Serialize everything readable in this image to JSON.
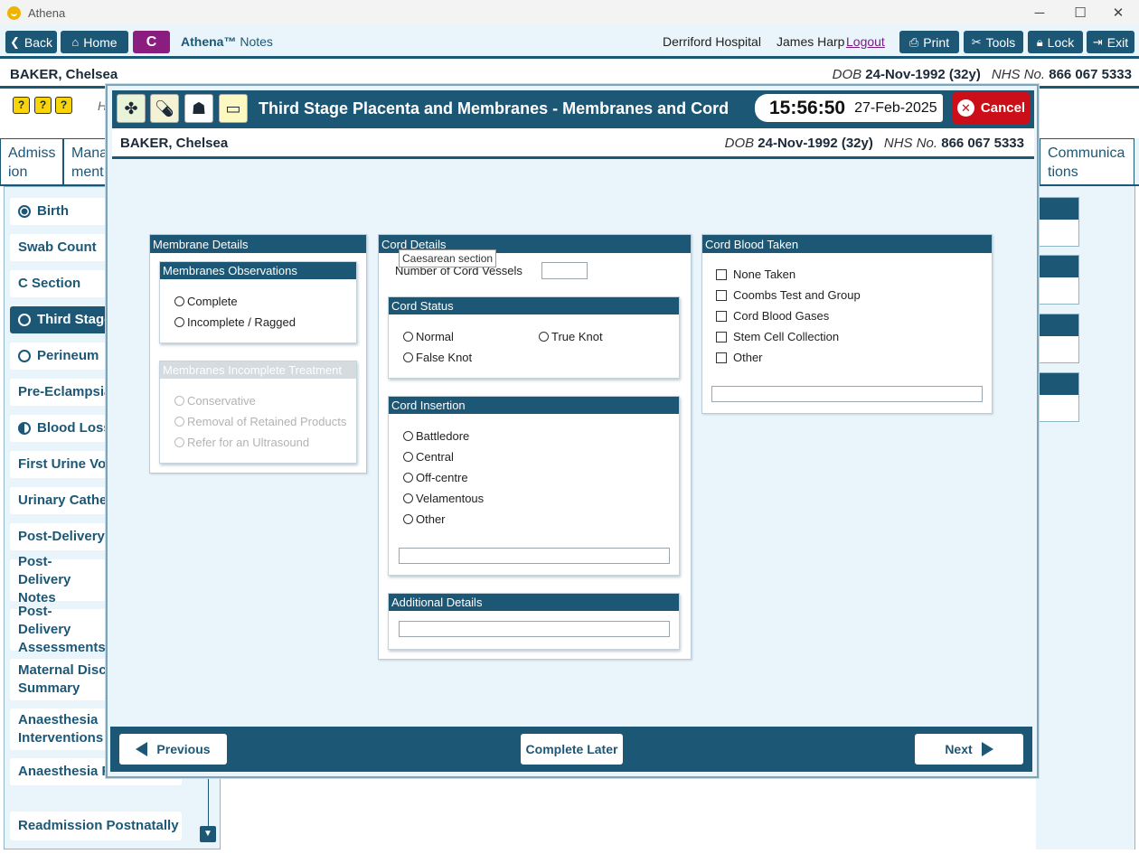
{
  "window": {
    "title": "Athena",
    "controls": [
      "─",
      "☐",
      "✕"
    ]
  },
  "toolbar": {
    "back": "Back",
    "home": "Home",
    "c_button": "C",
    "brand_main": "Athena™",
    "brand_sub": "Notes",
    "hospital": "Derriford Hospital",
    "user": "James Harp",
    "logout": "Logout",
    "print": "Print",
    "tools": "Tools",
    "lock": "Lock",
    "exit": "Exit"
  },
  "patient": {
    "name": "BAKER, Chelsea",
    "dob_label": "DOB",
    "dob": "24-Nov-1992 (32y)",
    "nhs_label": "NHS No.",
    "nhs": "866 067 5333"
  },
  "alerts": {
    "icons": [
      "?",
      "?",
      "?"
    ],
    "hint": "H"
  },
  "tabs": [
    {
      "label": "Admiss ion"
    },
    {
      "label": "Mana ment"
    },
    {
      "label": "Communica tions"
    }
  ],
  "sidebar": {
    "items": [
      {
        "label": "Birth",
        "state": "filled"
      },
      {
        "label": "Swab Count",
        "state": ""
      },
      {
        "label": "C Section",
        "state": ""
      },
      {
        "label": "Third Stage",
        "state": "empty",
        "active": true
      },
      {
        "label": "Perineum",
        "state": "empty"
      },
      {
        "label": "Pre-Eclampsia",
        "state": ""
      },
      {
        "label": "Blood Loss",
        "state": "half"
      },
      {
        "label": "First Urine Voi",
        "state": ""
      },
      {
        "label": "Urinary Cathe",
        "state": ""
      },
      {
        "label": "Post-Delivery",
        "state": ""
      },
      {
        "label": "Post-Delivery Notes",
        "state": ""
      },
      {
        "label": "Post-Delivery Assessments",
        "state": ""
      },
      {
        "label": "Maternal Disc Summary",
        "state": ""
      },
      {
        "label": "Anaesthesia Interventions",
        "state": ""
      },
      {
        "label": "Anaesthesia F",
        "state": ""
      },
      {
        "label": "Readmission Postnatally",
        "state": ""
      }
    ]
  },
  "dialog": {
    "title": "Third Stage Placenta and Membranes - Membranes and Cord",
    "time": "15:56:50",
    "date": "27-Feb-2025",
    "cancel": "Cancel",
    "membrane_details": {
      "header": "Membrane Details",
      "observations": {
        "header": "Membranes Observations",
        "options": [
          "Complete",
          "Incomplete / Ragged"
        ]
      },
      "incomplete_treatment": {
        "header": "Membranes Incomplete Treatment",
        "options": [
          "Conservative",
          "Removal of Retained Products",
          "Refer for an Ultrasound"
        ]
      }
    },
    "cord_details": {
      "header": "Cord Details",
      "tooltip": "Caesarean section",
      "vessels_label": "Number of Cord Vessels",
      "vessels_value": "",
      "status": {
        "header": "Cord Status",
        "options": [
          "Normal",
          "True Knot",
          "False Knot"
        ]
      },
      "insertion": {
        "header": "Cord Insertion",
        "options": [
          "Battledore",
          "Central",
          "Off-centre",
          "Velamentous",
          "Other"
        ],
        "other_text": ""
      },
      "additional": {
        "header": "Additional Details",
        "text": ""
      }
    },
    "cord_blood": {
      "header": "Cord Blood Taken",
      "options": [
        "None Taken",
        "Coombs Test and Group",
        "Cord Blood Gases",
        "Stem Cell Collection",
        "Other"
      ],
      "other_text": ""
    },
    "footer": {
      "previous": "Previous",
      "complete_later": "Complete Later",
      "next": "Next"
    }
  },
  "colors": {
    "primary": "#1c5776",
    "accent_purple": "#8b1d80",
    "cancel_red": "#cc0e18",
    "pane_bg": "#eaf5fb"
  }
}
